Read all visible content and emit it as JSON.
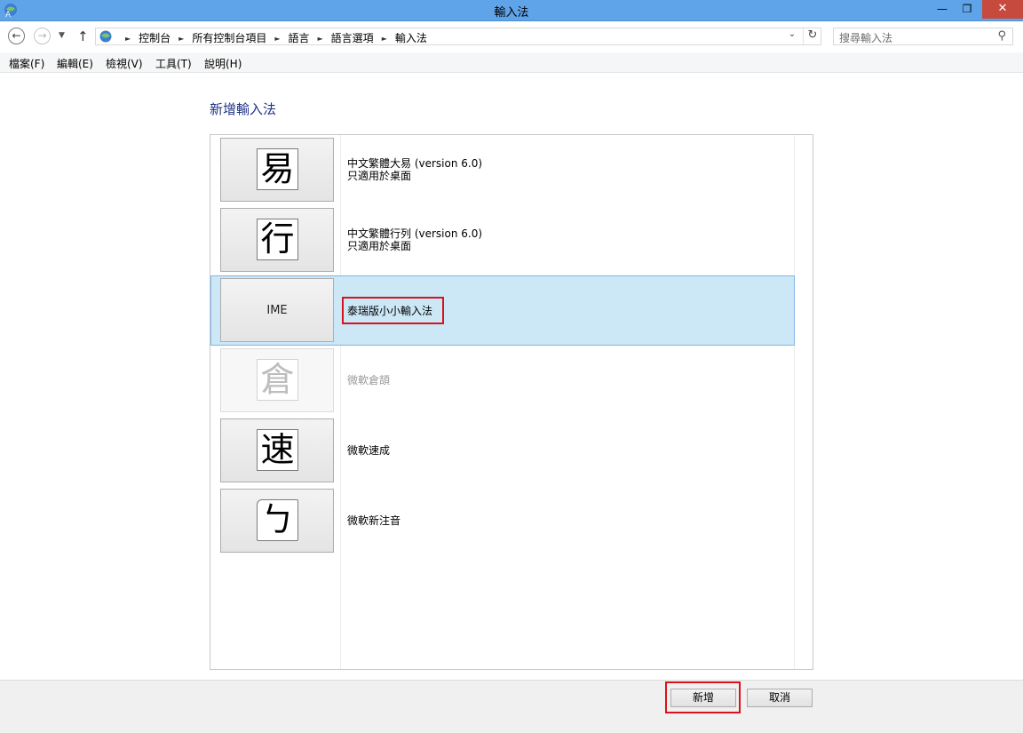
{
  "window": {
    "title": "輸入法",
    "minimize": "—",
    "maximize": "❐",
    "close": "✕"
  },
  "nav": {
    "breadcrumbs": [
      "控制台",
      "所有控制台項目",
      "語言",
      "語言選項",
      "輸入法"
    ],
    "separator": "►",
    "search_placeholder": "搜尋輸入法"
  },
  "menu": [
    "檔案(F)",
    "編輯(E)",
    "檢視(V)",
    "工具(T)",
    "說明(H)"
  ],
  "page": {
    "heading": "新增輸入法",
    "items": [
      {
        "glyph": "易",
        "label": "中文繁體大易 (version 6.0)",
        "sublabel": "只適用於桌面",
        "state": "normal"
      },
      {
        "glyph": "行",
        "label": "中文繁體行列 (version 6.0)",
        "sublabel": "只適用於桌面",
        "state": "normal"
      },
      {
        "glyph": "IME",
        "label": "泰瑞版小小輸入法",
        "sublabel": "",
        "state": "selected"
      },
      {
        "glyph": "倉",
        "label": "微軟倉頡",
        "sublabel": "",
        "state": "disabled"
      },
      {
        "glyph": "速",
        "label": "微軟速成",
        "sublabel": "",
        "state": "normal"
      },
      {
        "glyph": "ㄅ",
        "label": "微軟新注音",
        "sublabel": "",
        "state": "normal"
      }
    ]
  },
  "buttons": {
    "add": "新增",
    "cancel": "取消"
  },
  "colors": {
    "titlebar": "#5fa3e8",
    "selection": "#cce8f7",
    "highlight": "#d9121b",
    "heading": "#1e3287"
  }
}
